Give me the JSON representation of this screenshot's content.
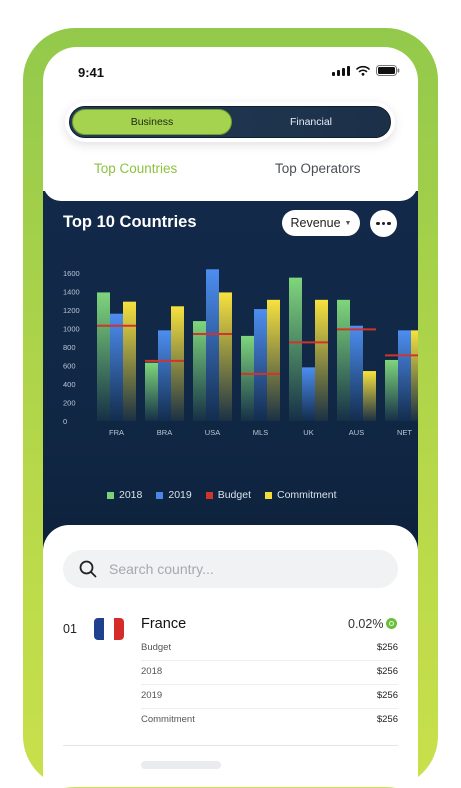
{
  "status_bar": {
    "time": "9:41"
  },
  "segmented": {
    "active": "Business",
    "inactive": "Financial"
  },
  "tabs": [
    {
      "label": "Top Countries"
    },
    {
      "label": "Top Operators"
    }
  ],
  "chart_header": {
    "title": "Top 10 Countries",
    "metric": "Revenue"
  },
  "chart_data": {
    "type": "bar",
    "title": "Top 10 Countries",
    "categories": [
      "FRA",
      "BRA",
      "USA",
      "MLS",
      "UK",
      "AUS",
      "NET"
    ],
    "ylim": [
      0,
      1600
    ],
    "yticks": [
      "0",
      "200",
      "400",
      "600",
      "800",
      "1000",
      "1200",
      "1400",
      "1600"
    ],
    "grid": false,
    "legend_position": "bottom",
    "series": [
      {
        "name": "2018",
        "color": "#7bd179",
        "values": [
          1390,
          630,
          1080,
          920,
          1550,
          1310,
          660
        ]
      },
      {
        "name": "2019",
        "color": "#4a86e8",
        "values": [
          1160,
          980,
          1640,
          1210,
          580,
          1030,
          980
        ]
      },
      {
        "name": "Budget",
        "color": "#d0342c",
        "type": "marker",
        "values": [
          1030,
          650,
          940,
          510,
          850,
          990,
          710
        ]
      },
      {
        "name": "Commitment",
        "color": "#f2dc3a",
        "values": [
          1290,
          1240,
          1390,
          1310,
          1310,
          540,
          980
        ]
      }
    ]
  },
  "search": {
    "placeholder": "Search country..."
  },
  "country_row": {
    "rank": "01",
    "name": "France",
    "percent": "0.02%",
    "flag_colors": [
      "#1f3f8f",
      "#ffffff",
      "#d62b2b"
    ],
    "details": [
      {
        "label": "Budget",
        "value": "$256"
      },
      {
        "label": "2018",
        "value": "$256"
      },
      {
        "label": "2019",
        "value": "$256"
      },
      {
        "label": "Commitment",
        "value": "$256"
      }
    ]
  }
}
